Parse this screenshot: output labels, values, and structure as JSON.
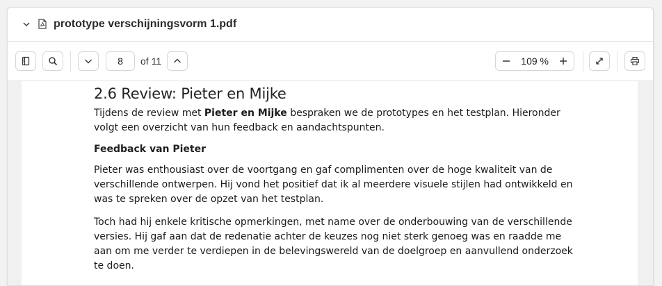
{
  "file": {
    "name": "prototype verschijningsvorm 1.pdf"
  },
  "toolbar": {
    "page_current": "8",
    "page_total_label": "of 11",
    "zoom": "109 %"
  },
  "document": {
    "heading": "2.6 Review: Pieter en Mijke",
    "intro_pre": "Tijdens de review met ",
    "intro_bold": "Pieter en Mijke",
    "intro_post": " bespraken we de prototypes en het testplan. Hieronder volgt een overzicht van hun feedback en aandachtspunten.",
    "subheading": "Feedback van Pieter",
    "paragraph_1": "Pieter was enthousiast over de voortgang en gaf complimenten over de hoge kwaliteit van de verschillende ontwerpen. Hij vond het positief dat ik al meerdere visuele stijlen had ontwikkeld en was te spreken over de opzet van het testplan.",
    "paragraph_2": "Toch had hij enkele kritische opmerkingen, met name over de onderbouwing van de verschillende versies. Hij gaf aan dat de redenatie achter de keuzes nog niet sterk genoeg was en raadde me aan om me verder te verdiepen in de belevingswereld van de doelgroep en aanvullend onderzoek te doen."
  },
  "icons": {
    "collapse": "chevron-down-icon",
    "file": "pdf-file-icon",
    "sidebar": "sidebar-toggle-icon",
    "search": "search-icon",
    "prev": "chevron-down-icon",
    "next": "chevron-up-icon",
    "zoom_out": "minus-icon",
    "zoom_in": "plus-icon",
    "fullscreen": "expand-icon",
    "print": "printer-icon"
  },
  "colors": {
    "border": "#d6d6d6",
    "icon": "#333333",
    "background": "#f0f0f0"
  }
}
